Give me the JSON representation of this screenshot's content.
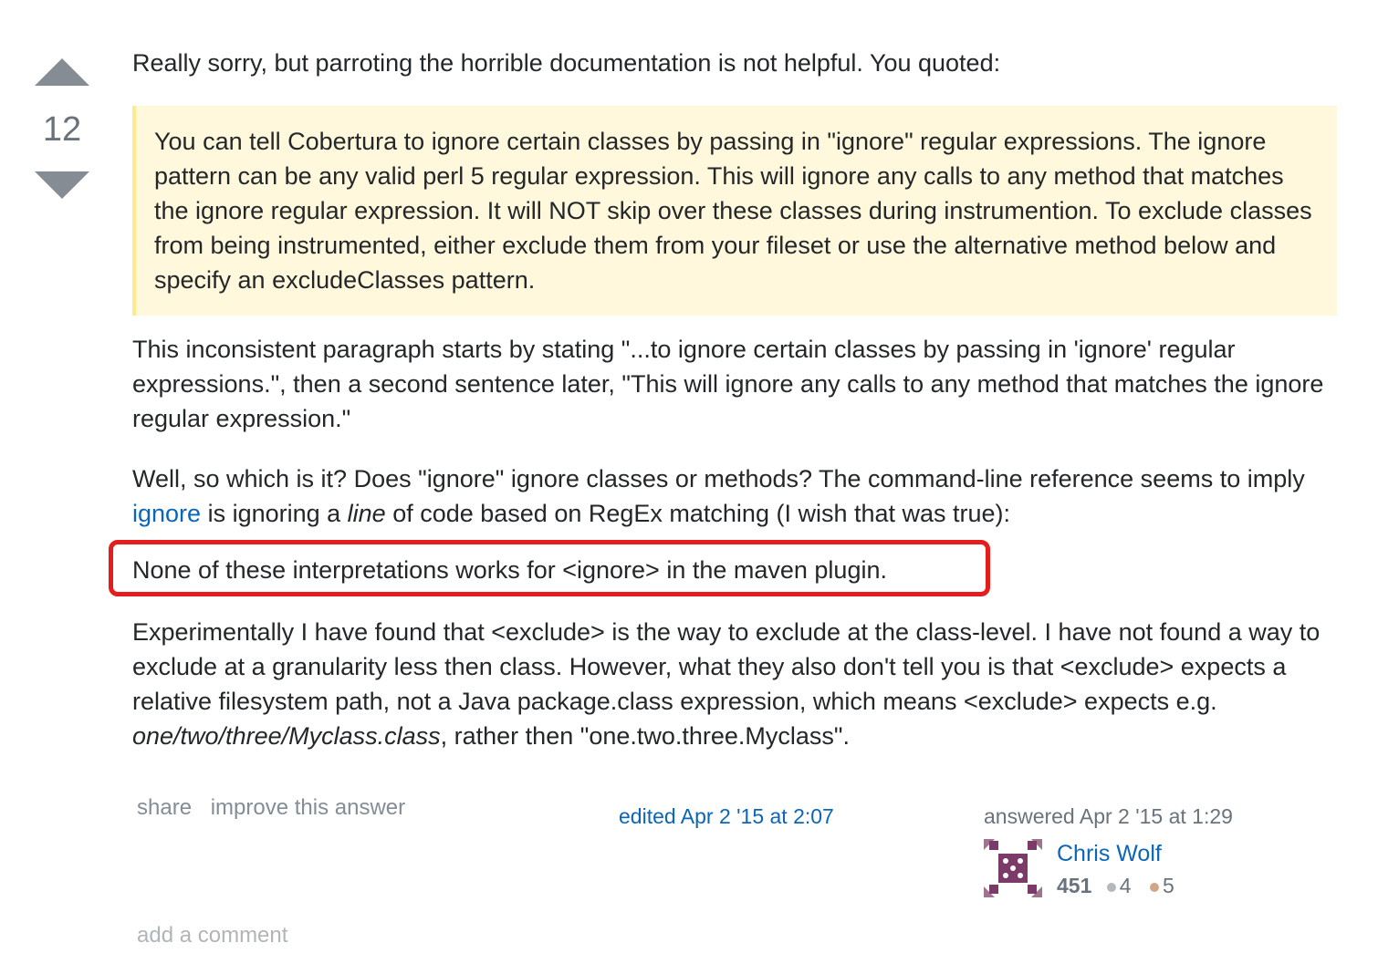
{
  "vote": {
    "count": "12"
  },
  "post": {
    "intro": "Really sorry, but parroting the horrible documentation is not helpful. You quoted:",
    "quote": "You can tell Cobertura to ignore certain classes by passing in \"ignore\" regular expressions. The ignore pattern can be any valid perl 5 regular expression. This will ignore any calls to any method that matches the ignore regular expression. It will NOT skip over these classes during instrumention. To exclude classes from being instrumented, either exclude them from your fileset or use the alternative method below and specify an excludeClasses pattern.",
    "paragraph2": "This inconsistent paragraph starts by stating \"...to ignore certain classes by passing in 'ignore' regular expressions.\", then a second sentence later, \"This will ignore any calls to any method that matches the ignore regular expression.\"",
    "paragraph3_part1": "Well, so which is it? Does \"ignore\" ignore classes or methods? The command-line reference seems to imply ",
    "paragraph3_link": "ignore",
    "paragraph3_part2": " is ignoring a ",
    "paragraph3_em": "line",
    "paragraph3_part3": " of code based on RegEx matching (I wish that was true):",
    "paragraph4": "None of these interpretations works for <ignore> in the maven plugin.",
    "paragraph5_part1": "Experimentally I have found that <exclude> is the way to exclude at the class-level. I have not found a way to exclude at a granularity less then class. However, what they also don't tell you is that <exclude> expects a relative filesystem path, not a Java package.class expression, which means <exclude> expects e.g. ",
    "paragraph5_em": "one/two/three/Myclass.class",
    "paragraph5_part2": ", rather then \"one.two.three.Myclass\"."
  },
  "footer": {
    "share": "share",
    "improve": "improve this answer",
    "edited": "edited Apr 2 '15 at 2:07",
    "answered": "answered Apr 2 '15 at 1:29",
    "user": {
      "name": "Chris Wolf",
      "reputation": "451",
      "silver_badges": "4",
      "bronze_badges": "5"
    },
    "add_comment": "add a comment"
  },
  "colors": {
    "highlight_border": "#e51d1d",
    "quote_bg": "#fff8dc",
    "link": "#0c65b7"
  }
}
